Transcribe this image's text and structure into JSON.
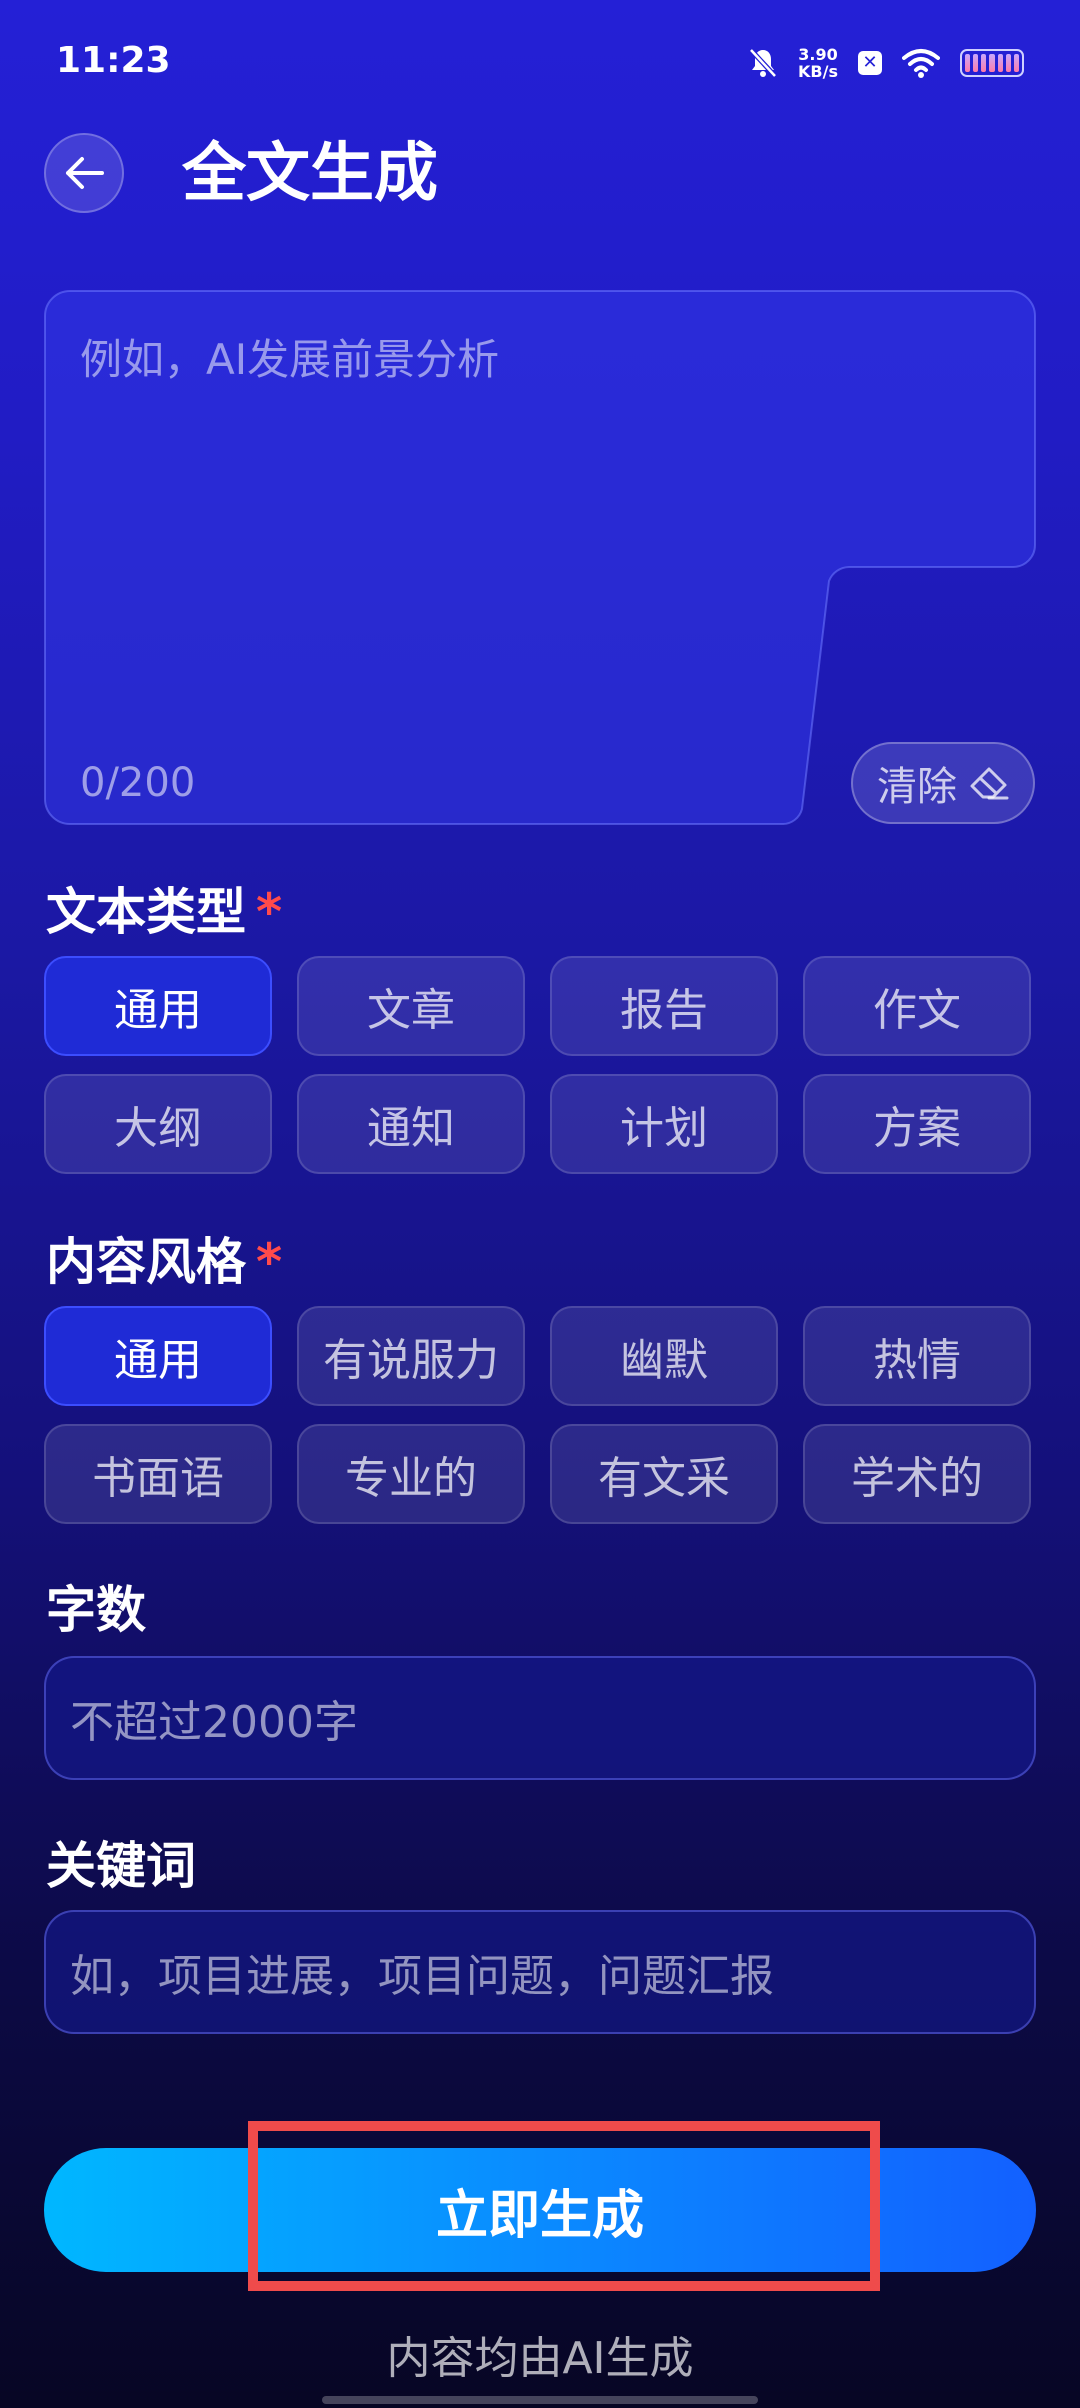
{
  "status_bar": {
    "time": "11:23",
    "net_speed_value": "3.90",
    "net_speed_unit": "KB/s",
    "icons": [
      "mute-bell-icon",
      "x-app-icon",
      "wifi-icon",
      "battery-icon"
    ]
  },
  "header": {
    "title": "全文生成",
    "back_icon": "arrow-left-icon"
  },
  "prompt": {
    "placeholder": "例如，AI发展前景分析",
    "count": "0/200",
    "clear_label": "清除",
    "clear_icon": "eraser-icon"
  },
  "text_type": {
    "label": "文本类型",
    "required_mark": "*",
    "options": [
      "通用",
      "文章",
      "报告",
      "作文",
      "大纲",
      "通知",
      "计划",
      "方案"
    ],
    "selected": "通用"
  },
  "content_style": {
    "label": "内容风格",
    "required_mark": "*",
    "options": [
      "通用",
      "有说服力",
      "幽默",
      "热情",
      "书面语",
      "专业的",
      "有文采",
      "学术的"
    ],
    "selected": "通用"
  },
  "word_count": {
    "label": "字数",
    "placeholder": "不超过2000字"
  },
  "keywords": {
    "label": "关键词",
    "placeholder": "如，项目进展，项目问题，问题汇报"
  },
  "generate_button": "立即生成",
  "footer_note": "内容均由AI生成",
  "colors": {
    "background_top": "#2420d6",
    "background_bottom": "#070624",
    "selected_chip": "#1f2bd6",
    "required": "#ff4b4b",
    "button_start": "#00b7ff",
    "button_end": "#1360ff",
    "highlight": "#ef4b4b"
  }
}
